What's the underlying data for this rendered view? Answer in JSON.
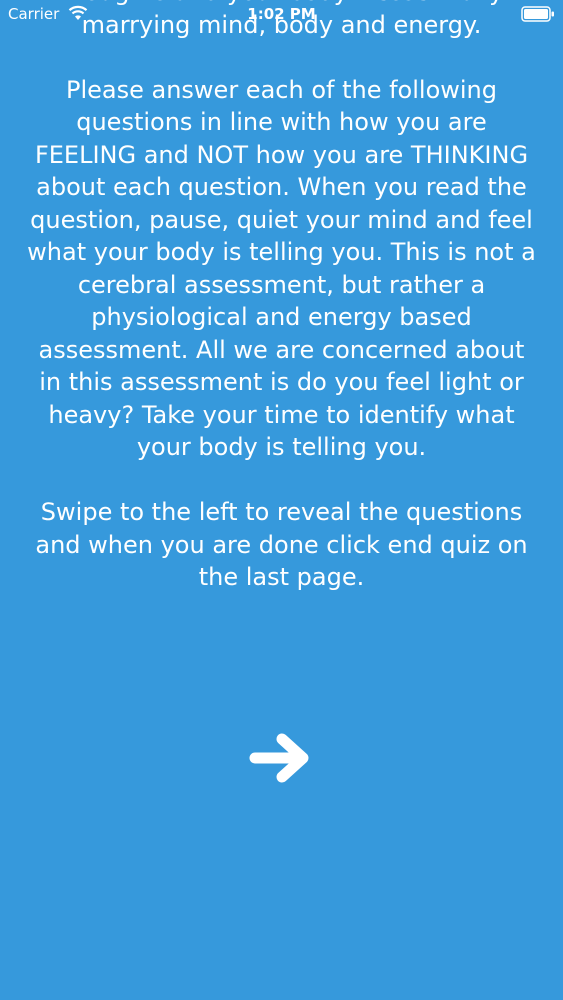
{
  "status_bar": {
    "carrier": "Carrier",
    "time": "1:02 PM",
    "wifi_icon": "wifi-icon",
    "battery_icon": "battery-icon"
  },
  "content": {
    "intro_fragment": "thoughts and your body – essentially marrying mind, body and energy.",
    "instructions": "Please answer each of the following questions in line with how you are FEELING and NOT how you are THINKING about each question. When you read the question, pause, quiet your mind and feel what your body is telling you. This is not a cerebral assessment, but rather a physiological and energy based assessment. All we are concerned about in this assessment is do you feel light or heavy? Take your time to identify what your body is telling you.",
    "swipe_hint": "Swipe to the left to reveal the questions and when you are done click end quiz on the last page."
  },
  "navigation": {
    "next_icon": "arrow-right-icon"
  },
  "colors": {
    "background": "#3699dc",
    "text": "#ffffff"
  }
}
